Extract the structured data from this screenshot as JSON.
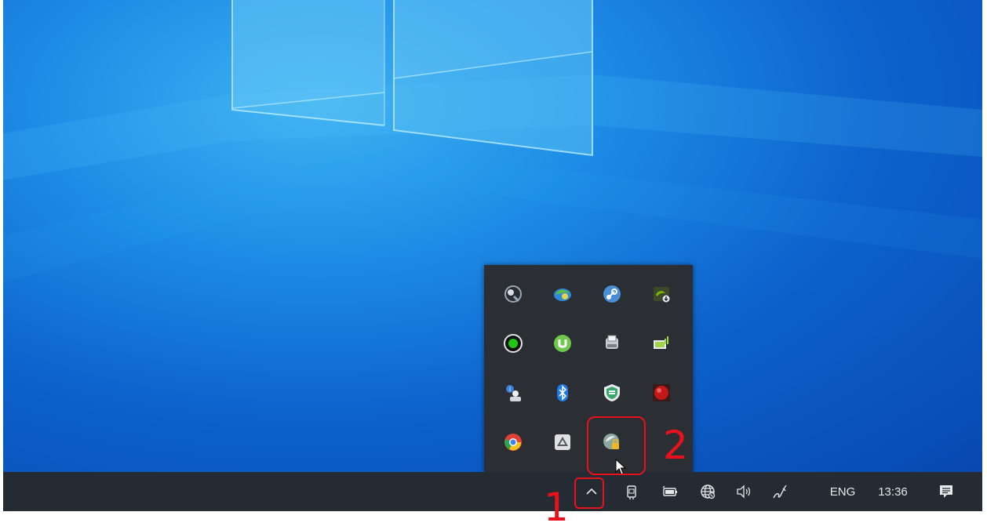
{
  "tray_flyout": {
    "icons": [
      {
        "name": "speaker-tray-icon",
        "color": "#9aa6b4"
      },
      {
        "name": "network-globe-tray-icon",
        "color": "#5fbf3a"
      },
      {
        "name": "steam-tray-icon",
        "color": "#4a8fd6"
      },
      {
        "name": "nvidia-tray-icon",
        "color": "#76b900"
      },
      {
        "name": "green-circle-tray-icon",
        "color": "#22c414"
      },
      {
        "name": "utorrent-tray-icon",
        "color": "#6cc94b"
      },
      {
        "name": "printer-tray-icon",
        "color": "#c8ccd2"
      },
      {
        "name": "display-tray-icon",
        "color": "#9fd34a"
      },
      {
        "name": "info-user-tray-icon",
        "color": "#3b7fe0"
      },
      {
        "name": "bluetooth-tray-icon",
        "color": "#1e7ae8"
      },
      {
        "name": "security-shield-tray-icon",
        "color": "#35a86a"
      },
      {
        "name": "red-app-tray-icon",
        "color": "#c41818"
      },
      {
        "name": "chrome-tray-icon",
        "color": "#e34133"
      },
      {
        "name": "google-drive-tray-icon",
        "color": "#e0e0e0"
      },
      {
        "name": "vpn-lock-tray-icon",
        "color": "#f0b429"
      }
    ]
  },
  "taskbar": {
    "language": "ENG",
    "time": "13:36",
    "icons": [
      "chevron-up-icon",
      "tablet-mode-icon",
      "battery-icon",
      "network-globe-icon",
      "volume-icon",
      "pen-icon",
      "notification-center-icon"
    ]
  },
  "annotations": {
    "label_1": "1",
    "label_2": "2",
    "color": "#e8121d"
  }
}
